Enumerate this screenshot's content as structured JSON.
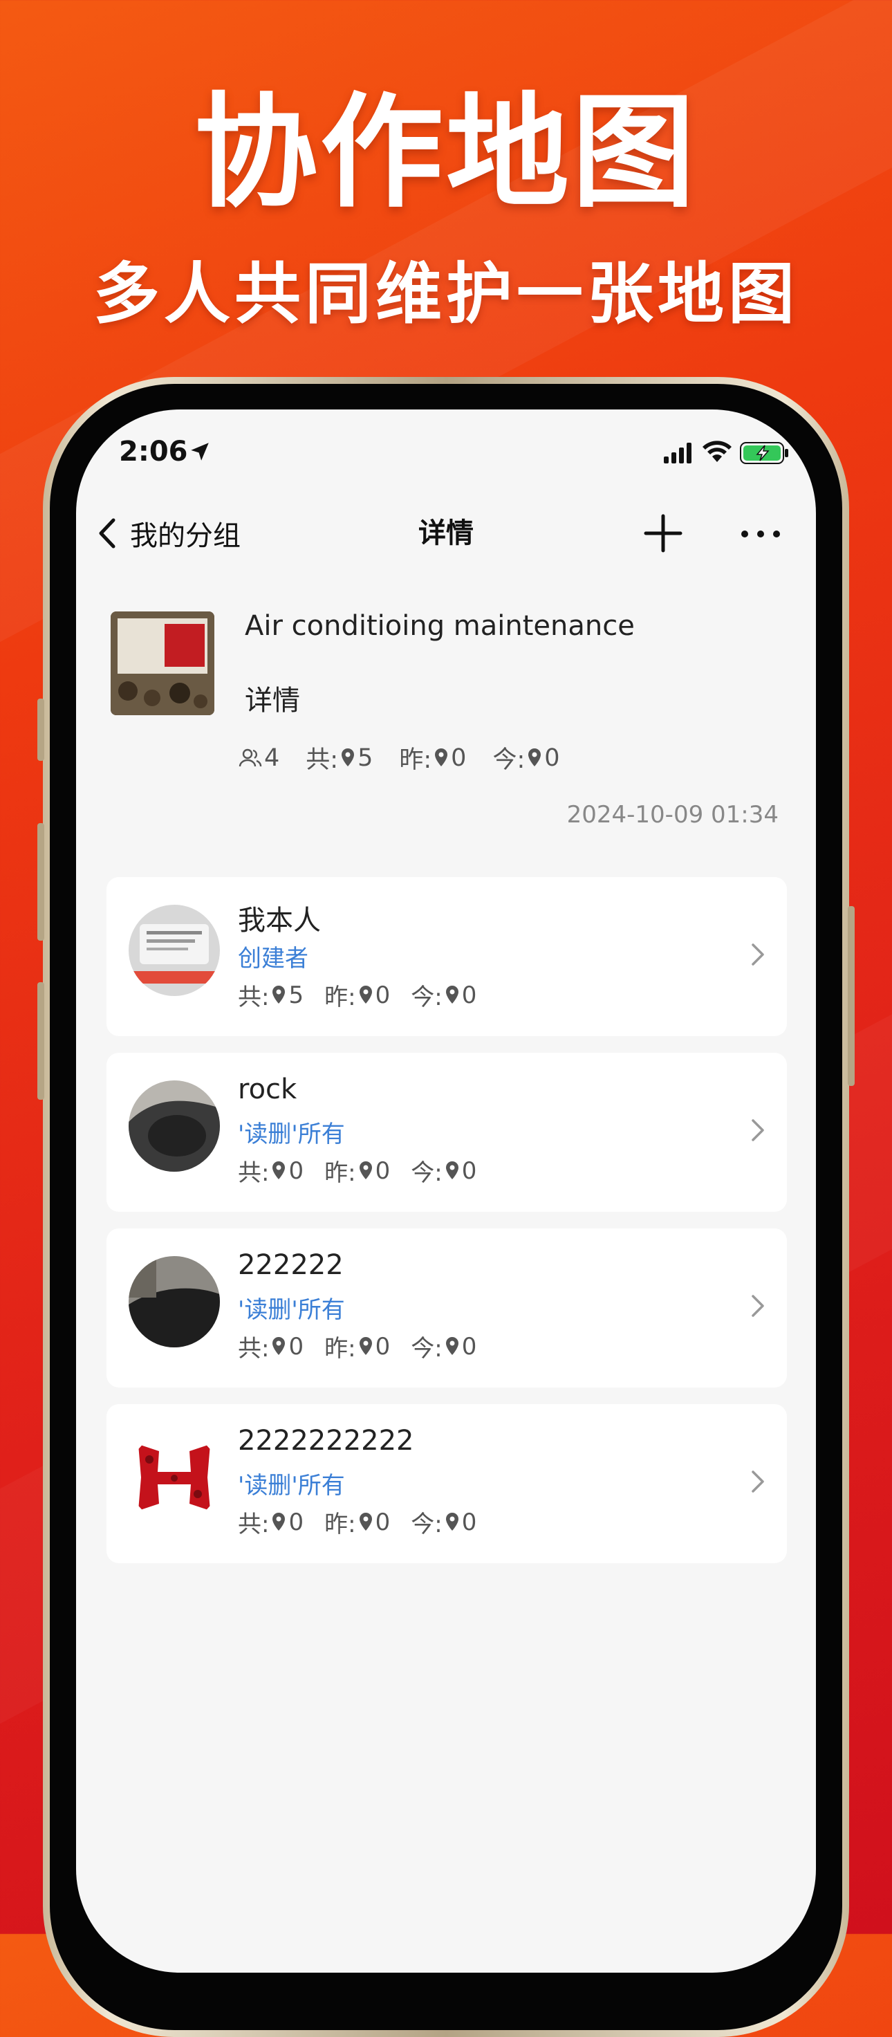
{
  "hero": {
    "title": "协作地图",
    "subtitle": "多人共同维护一张地图"
  },
  "status_bar": {
    "time": "2:06",
    "location_icon": "location-arrow-icon",
    "signal_icon": "cellular-signal-icon",
    "wifi_icon": "wifi-icon",
    "battery_icon": "battery-charging-icon"
  },
  "nav": {
    "back_label": "我的分组",
    "title": "详情",
    "add_icon": "plus-icon",
    "more_icon": "more-dots-icon"
  },
  "group": {
    "name": "Air conditioing maintenance",
    "detail": "详情",
    "members_count": "4",
    "total_label": "共:",
    "total_value": "5",
    "yesterday_label": "昨:",
    "yesterday_value": "0",
    "today_label": "今:",
    "today_value": "0",
    "date": "2024-10-09 01:34"
  },
  "members": [
    {
      "name": "我本人",
      "role": "创建者",
      "total_label": "共:",
      "total": "5",
      "yesterday_label": "昨:",
      "yesterday": "0",
      "today_label": "今:",
      "today": "0"
    },
    {
      "name": "rock",
      "role": "'读删'所有",
      "total_label": "共:",
      "total": "0",
      "yesterday_label": "昨:",
      "yesterday": "0",
      "today_label": "今:",
      "today": "0"
    },
    {
      "name": "222222",
      "role": "'读删'所有",
      "total_label": "共:",
      "total": "0",
      "yesterday_label": "昨:",
      "yesterday": "0",
      "today_label": "今:",
      "today": "0"
    },
    {
      "name": "2222222222",
      "role": "'读删'所有",
      "total_label": "共:",
      "total": "0",
      "yesterday_label": "昨:",
      "yesterday": "0",
      "today_label": "今:",
      "today": "0"
    }
  ],
  "colors": {
    "accent_blue": "#3b7fd6",
    "background_red": "#e0201a",
    "battery_green": "#34c759"
  }
}
